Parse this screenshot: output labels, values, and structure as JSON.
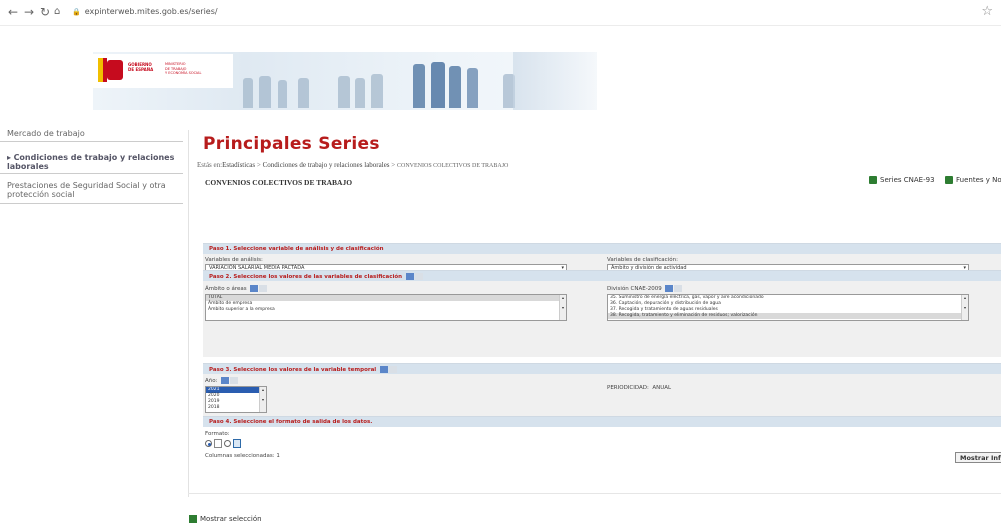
{
  "browser": {
    "url": "expinterweb.mites.gob.es/series/"
  },
  "banner": {
    "gov": "GOBIERNO\nDE ESPAÑA",
    "ministry": "MINISTERIO\nDE TRABAJO\nY ECONOMÍA SOCIAL"
  },
  "sidebar": {
    "items": [
      {
        "label": "Mercado de trabajo"
      },
      {
        "label": "Condiciones de trabajo y relaciones laborales"
      },
      {
        "label": "Prestaciones de Seguridad Social y otra protección social"
      }
    ]
  },
  "main": {
    "title": "Principales Series",
    "breadcrumb": {
      "prefix": "Estás en:",
      "p1": "Estadísticas",
      "p2": "Condiciones de trabajo y relaciones laborales",
      "p3": "CONVENIOS COLECTIVOS DE TRABAJO",
      "sep": ">"
    },
    "section_title": "CONVENIOS COLECTIVOS DE TRABAJO",
    "btn_series": "Series CNAE-93",
    "btn_fuentes": "Fuentes y Not"
  },
  "step1": {
    "title": "Paso 1. Seleccione variable de análisis y de clasificación",
    "analysis_label": "Variables de análisis:",
    "analysis_value": "VARIACIÓN SALARIAL MEDIA PACTADA",
    "class_label": "Variables de clasificación:",
    "class_value": "Ámbito y división de actividad"
  },
  "step2": {
    "title": "Paso 2. Seleccione los valores de las variables de clasificación",
    "ambito_label": "Ámbito o áreas",
    "ambito_items": [
      "TOTAL",
      "Ámbito de empresa",
      "Ámbito superior a la empresa"
    ],
    "division_label": "División CNAE-2009",
    "division_items": [
      "35. Suministro de energía eléctrica, gas, vapor y aire acondicionado",
      "36. Captación, depuración y distribución de agua",
      "37. Recogida y tratamiento de aguas residuales",
      "38. Recogida, tratamiento y eliminación de residuos; valorización"
    ]
  },
  "step3": {
    "title": "Paso 3. Seleccione los valores de la variable temporal",
    "year_label": "Año:",
    "years": [
      "2021",
      "2020",
      "2019",
      "2018"
    ],
    "periodicity_label": "PERIODICIDAD:",
    "periodicity_value": "ANUAL"
  },
  "step4": {
    "title": "Paso 4. Seleccione el formato de salida de los datos.",
    "format_label": "Formato:",
    "columns": "Columnas seleccionadas: 1",
    "show_button": "Mostrar Informe"
  },
  "footer": {
    "show_selection": "Mostrar selección"
  }
}
